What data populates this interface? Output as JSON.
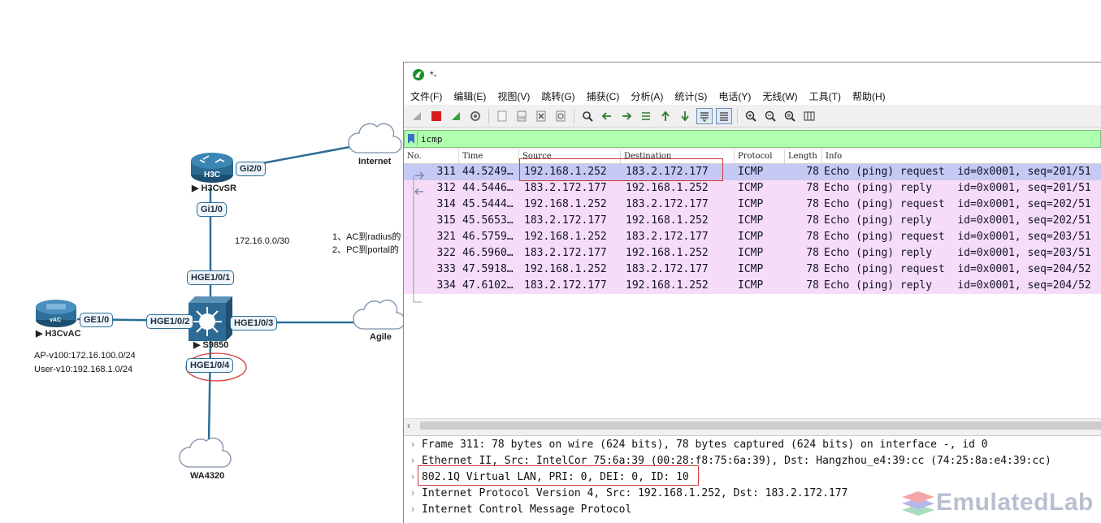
{
  "topology": {
    "devices": {
      "router": {
        "name": "H3CvSR",
        "badge": "H3C"
      },
      "switch": {
        "name": "S9850"
      },
      "ac": {
        "name": "H3CvAC",
        "badge": "vAC"
      }
    },
    "clouds": {
      "internet": "Internet",
      "agile": "Agile",
      "ap": "WA4320"
    },
    "ports": {
      "gi2_0": "Gi2/0",
      "gi1_0": "Gi1/0",
      "hge1_0_1": "HGE1/0/1",
      "hge1_0_2": "HGE1/0/2",
      "hge1_0_3": "HGE1/0/3",
      "hge1_0_4": "HGE1/0/4",
      "ge1_0": "GE1/0"
    },
    "subnet_label": "172.16.0.0/30",
    "ac_notes": [
      "AP-v100:172.16.100.0/24",
      "User-v10:192.168.1.0/24"
    ],
    "notes": [
      "1、AC到radius的",
      "2、PC到portal的"
    ]
  },
  "wireshark": {
    "title": "*-",
    "menu": [
      "文件(F)",
      "编辑(E)",
      "视图(V)",
      "跳转(G)",
      "捕获(C)",
      "分析(A)",
      "统计(S)",
      "电话(Y)",
      "无线(W)",
      "工具(T)",
      "帮助(H)"
    ],
    "filter": "icmp",
    "columns": [
      "No.",
      "Time",
      "Source",
      "Destination",
      "Protocol",
      "Length",
      "Info"
    ],
    "packets": [
      {
        "no": "311",
        "time": "44.5249…",
        "src": "192.168.1.252",
        "dst": "183.2.172.177",
        "proto": "ICMP",
        "len": "78",
        "info": "Echo (ping) request  id=0x0001, seq=201/51"
      },
      {
        "no": "312",
        "time": "44.5446…",
        "src": "183.2.172.177",
        "dst": "192.168.1.252",
        "proto": "ICMP",
        "len": "78",
        "info": "Echo (ping) reply    id=0x0001, seq=201/51"
      },
      {
        "no": "314",
        "time": "45.5444…",
        "src": "192.168.1.252",
        "dst": "183.2.172.177",
        "proto": "ICMP",
        "len": "78",
        "info": "Echo (ping) request  id=0x0001, seq=202/51"
      },
      {
        "no": "315",
        "time": "45.5653…",
        "src": "183.2.172.177",
        "dst": "192.168.1.252",
        "proto": "ICMP",
        "len": "78",
        "info": "Echo (ping) reply    id=0x0001, seq=202/51"
      },
      {
        "no": "321",
        "time": "46.5759…",
        "src": "192.168.1.252",
        "dst": "183.2.172.177",
        "proto": "ICMP",
        "len": "78",
        "info": "Echo (ping) request  id=0x0001, seq=203/51"
      },
      {
        "no": "322",
        "time": "46.5960…",
        "src": "183.2.172.177",
        "dst": "192.168.1.252",
        "proto": "ICMP",
        "len": "78",
        "info": "Echo (ping) reply    id=0x0001, seq=203/51"
      },
      {
        "no": "333",
        "time": "47.5918…",
        "src": "192.168.1.252",
        "dst": "183.2.172.177",
        "proto": "ICMP",
        "len": "78",
        "info": "Echo (ping) request  id=0x0001, seq=204/52"
      },
      {
        "no": "334",
        "time": "47.6102…",
        "src": "183.2.172.177",
        "dst": "192.168.1.252",
        "proto": "ICMP",
        "len": "78",
        "info": "Echo (ping) reply    id=0x0001, seq=204/52"
      }
    ],
    "details": [
      "Frame 311: 78 bytes on wire (624 bits), 78 bytes captured (624 bits) on interface -, id 0",
      "Ethernet II, Src: IntelCor_75:6a:39 (00:28:f8:75:6a:39), Dst: Hangzhou_e4:39:cc (74:25:8a:e4:39:cc)",
      "802.1Q Virtual LAN, PRI: 0, DEI: 0, ID: 10",
      "Internet Protocol Version 4, Src: 192.168.1.252, Dst: 183.2.172.177",
      "Internet Control Message Protocol"
    ]
  },
  "watermark": "EmulatedLab",
  "colors": {
    "selected_row": "#c5c9f3",
    "icmp_row": "#f7dcf7",
    "filter_ok": "#afffaf",
    "annotation_red": "#d23b3b",
    "link_blue": "#2f6d93"
  }
}
